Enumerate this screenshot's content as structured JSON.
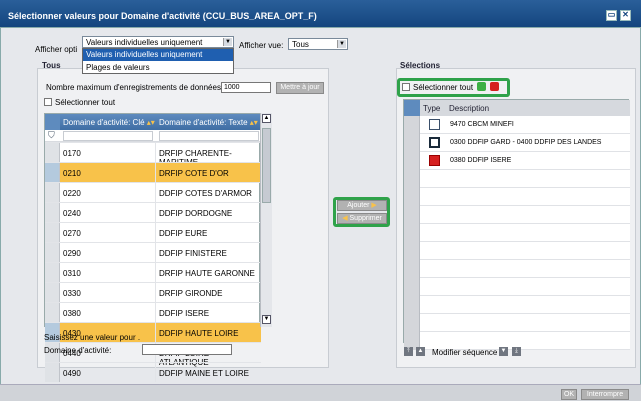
{
  "window": {
    "title": "Sélectionner valeurs pour Domaine d'activité (CCU_BUS_AREA_OPT_F)"
  },
  "toolbar": {
    "afficher_options_label": "Afficher opti",
    "afficher_options_value": "Valeurs individuelles uniquement",
    "dropdown_options": [
      "Valeurs individuelles uniquement",
      "Plages de valeurs"
    ],
    "afficher_vue_label": "Afficher vue:",
    "afficher_vue_value": "Tous"
  },
  "left_panel": {
    "tab_label": "Tous",
    "max_records_label": "Nombre maximum d'enregistrements de données:",
    "max_records_value": "1000",
    "update_button": "Mettre à jour",
    "select_all_label": "Sélectionner tout",
    "columns": [
      "Domaine d'activité: Clé",
      "Domaine d'activité: Texte"
    ],
    "rows": [
      {
        "key": "0170",
        "text": "DRFIP CHARENTE-MARITIME",
        "highlighted": false
      },
      {
        "key": "0210",
        "text": "DRFIP COTE D'OR",
        "highlighted": true
      },
      {
        "key": "0220",
        "text": "DDFIP COTES D'ARMOR",
        "highlighted": false
      },
      {
        "key": "0240",
        "text": "DDFIP DORDOGNE",
        "highlighted": false
      },
      {
        "key": "0270",
        "text": "DDFIP EURE",
        "highlighted": false
      },
      {
        "key": "0290",
        "text": "DDFIP FINISTERE",
        "highlighted": false
      },
      {
        "key": "0310",
        "text": "DRFIP HAUTE GARONNE",
        "highlighted": false
      },
      {
        "key": "0330",
        "text": "DRFIP GIRONDE",
        "highlighted": false
      },
      {
        "key": "0380",
        "text": "DDFIP ISERE",
        "highlighted": false
      },
      {
        "key": "0430",
        "text": "DDFIP HAUTE LOIRE",
        "highlighted": true
      },
      {
        "key": "0440",
        "text": "DRFIP LOIRE-ATLANTIQUE",
        "highlighted": false
      },
      {
        "key": "0490",
        "text": "DDFIP MAINE ET LOIRE",
        "highlighted": false
      }
    ],
    "enter_value_label": "Saisissez une valeur pour .",
    "domaine_label": "Domaine d'activité:"
  },
  "middle": {
    "add_button": "Ajouter",
    "remove_button": "Supprimer"
  },
  "right_panel": {
    "title": "Sélections",
    "select_all_label": "Sélectionner tout",
    "columns": [
      "Type",
      "Description"
    ],
    "rows": [
      {
        "type_icon": "single-value-icon",
        "description": "9470 CBCM MINEFI"
      },
      {
        "type_icon": "range-icon",
        "description": "0300 DDFIP GARD - 0400 DDFIP DES LANDES"
      },
      {
        "type_icon": "exclude-icon",
        "description": "0380 DDFIP ISERE"
      }
    ],
    "modify_sequence_label": "Modifier séquence"
  },
  "footer": {
    "ok_button": "OK",
    "cancel_button": "Interrompre"
  },
  "colors": {
    "title_bar": "#14457e",
    "highlight": "#f8c24a",
    "green_outline": "#2fa24a",
    "header": "#3f6ea4"
  }
}
